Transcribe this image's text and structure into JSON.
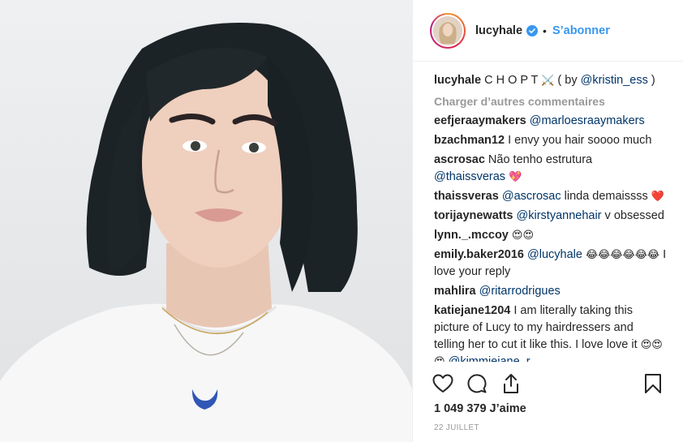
{
  "post": {
    "username": "lucyhale",
    "follow_label": "S’abonner",
    "separator": "•",
    "caption": {
      "user": "lucyhale",
      "text": "C H O P T",
      "emoji": "⚔️",
      "credit_prefix": " ( by ",
      "credit_mention": "@kristin_ess",
      "credit_suffix": " )"
    },
    "load_more_label": "Charger d’autres commentaires",
    "comments": [
      {
        "user": "eefjeraaymakers",
        "mention": "@marloesraaymakers",
        "text": "",
        "emoji": ""
      },
      {
        "user": "bzachman12",
        "mention": "",
        "text": "I envy you hair soooo much",
        "emoji": ""
      },
      {
        "user": "ascrosac",
        "mention": "@thaissveras",
        "text": "Não tenho estrutura",
        "emoji": "💖"
      },
      {
        "user": "thaissveras",
        "mention": "@ascrosac",
        "text": "linda demaissss",
        "emoji": "❤️"
      },
      {
        "user": "torijaynewatts",
        "mention": "@kirstyannehair",
        "text": "v obsessed",
        "emoji": ""
      },
      {
        "user": "lynn._.mccoy",
        "mention": "",
        "text": "",
        "emoji": "😍😍"
      },
      {
        "user": "emily.baker2016",
        "mention": "@lucyhale",
        "text": "I love your reply",
        "emoji": "😂😂😂😂😂😂"
      },
      {
        "user": "mahlira",
        "mention": "@ritarrodrigues",
        "text": "",
        "emoji": ""
      },
      {
        "user": "katiejane1204",
        "mention": "@kimmiejane_r",
        "text": "I am literally taking this picture of Lucy to my hairdressers and telling her to cut it like this. I love love it",
        "emoji": "😍😍😍"
      }
    ],
    "likes_label": "1 049 379 J’aime",
    "date": "22 JUILLET",
    "icons": {
      "like": "heart-icon",
      "comment": "comment-icon",
      "share": "share-icon",
      "save": "bookmark-icon",
      "verified": "verified-badge-icon"
    },
    "colors": {
      "accent": "#3897f0",
      "mention": "#003569",
      "muted": "#999999"
    }
  }
}
